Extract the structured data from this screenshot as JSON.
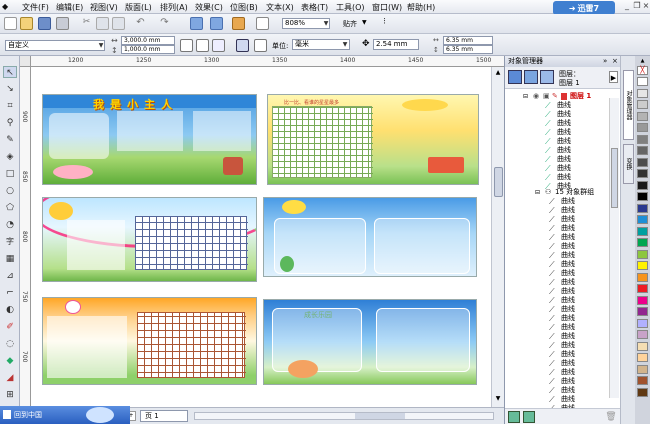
{
  "menu": [
    "文件(F)",
    "编辑(E)",
    "视图(V)",
    "版面(L)",
    "排列(A)",
    "效果(C)",
    "位图(B)",
    "文本(X)",
    "表格(T)",
    "工具(O)",
    "窗口(W)",
    "帮助(H)"
  ],
  "brand": "迅雷7",
  "toolbar1": {
    "zoom": "808%",
    "snap": "贴齐"
  },
  "toolbar2": {
    "preset": "自定义",
    "width": "3,000.0 mm",
    "height": "1,000.0 mm",
    "units_label": "单位:",
    "units": "毫米",
    "nudge": "2.54 mm",
    "dup_x": "6.35 mm",
    "dup_y": "6.35 mm"
  },
  "ruler_top": [
    "1200",
    "1250",
    "1300",
    "1350",
    "1400",
    "1450",
    "1500"
  ],
  "ruler_left": [
    "900",
    "850",
    "800",
    "750",
    "700",
    "650"
  ],
  "thumbs": [
    {
      "title": "我是小主人"
    },
    {
      "title": "比一比、看谁的星星最多"
    },
    {
      "title": ""
    },
    {
      "title": ""
    },
    {
      "title": ""
    },
    {
      "title": "成长乐园"
    }
  ],
  "object_manager": {
    "title": "对象管理器",
    "layer_label": "图层：",
    "layer_value": "图层 1",
    "top_layer": "图层 1",
    "group": "15 对象群组",
    "items": [
      "曲线",
      "曲线",
      "曲线",
      "曲线",
      "曲线",
      "曲线",
      "曲线",
      "曲线",
      "曲线",
      "曲线",
      "曲线",
      "曲线",
      "曲线",
      "曲线",
      "曲线",
      "曲线",
      "曲线",
      "曲线",
      "曲线",
      "曲线",
      "曲线",
      "曲线",
      "曲线",
      "曲线",
      "曲线",
      "曲线",
      "曲线",
      "曲线",
      "曲线",
      "曲线",
      "曲线",
      "曲线",
      "曲线",
      "曲线"
    ]
  },
  "dock_tabs": [
    "对象管理器",
    "变换"
  ],
  "palette": [
    "#ffffff",
    "#e6e6e6",
    "#cccccc",
    "#b3b3b3",
    "#999999",
    "#808080",
    "#666666",
    "#4d4d4d",
    "#333333",
    "#1a1a1a",
    "#000000",
    "#2b3a8f",
    "#1e8fd6",
    "#00a0a0",
    "#00a651",
    "#8dc63f",
    "#fff200",
    "#f7941d",
    "#ed1c24",
    "#ec008c",
    "#92278f",
    "#b0b0ff",
    "#c8a2c8",
    "#f5deb3",
    "#ffd39b",
    "#d2b48c",
    "#a0522d",
    "#603913"
  ],
  "page_tab": "页 1",
  "taskbar": "回到中国"
}
